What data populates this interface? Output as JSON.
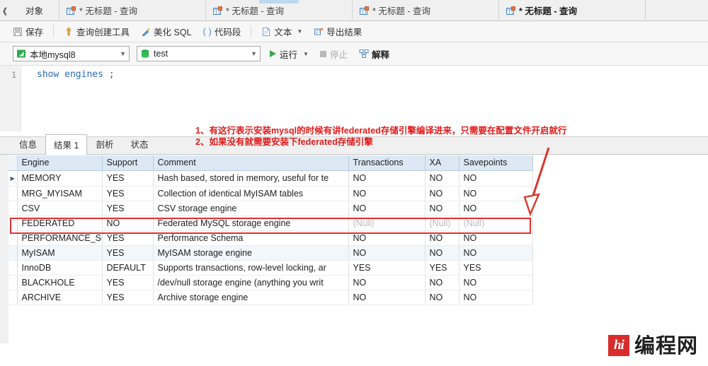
{
  "window": {
    "tabs": [
      {
        "label": "对象",
        "type": "object",
        "active": false
      },
      {
        "label": "* 无标题 - 查询",
        "type": "query",
        "active": false
      },
      {
        "label": "* 无标题 - 查询",
        "type": "query",
        "active": false
      },
      {
        "label": "* 无标题 - 查询",
        "type": "query",
        "active": false
      },
      {
        "label": "* 无标题 - 查询",
        "type": "query",
        "active": true
      }
    ]
  },
  "toolbar": {
    "save": "保存",
    "query_builder": "查询创建工具",
    "beautify": "美化 SQL",
    "snippet": "代码段",
    "snippet_prefix": "( )",
    "text": "文本",
    "export": "导出结果"
  },
  "connbar": {
    "connection": "本地mysql8",
    "database": "test",
    "run": "运行",
    "stop": "停止",
    "explain": "解释"
  },
  "editor": {
    "line_number": "1",
    "sql_keyword1": "show",
    "sql_keyword2": "engines",
    "sql_punct": ";"
  },
  "annotation": {
    "line1": "1、有这行表示安装mysql的时候有讲federated存储引擎编译进来，只需要在配置文件开启就行",
    "line2": "2、如果没有就需要安装下federated存储引擎",
    "color": "#e01b1b"
  },
  "result_tabs": [
    {
      "label": "信息",
      "selected": false
    },
    {
      "label": "结果 1",
      "selected": true
    },
    {
      "label": "剖析",
      "selected": false
    },
    {
      "label": "状态",
      "selected": false
    }
  ],
  "grid": {
    "columns": [
      "Engine",
      "Support",
      "Comment",
      "Transactions",
      "XA",
      "Savepoints"
    ],
    "rows": [
      {
        "current": true,
        "highlight": false,
        "cells": [
          "MEMORY",
          "YES",
          "Hash based, stored in memory, useful for te",
          "NO",
          "NO",
          "NO"
        ]
      },
      {
        "current": false,
        "highlight": false,
        "cells": [
          "MRG_MYISAM",
          "YES",
          "Collection of identical MyISAM tables",
          "NO",
          "NO",
          "NO"
        ]
      },
      {
        "current": false,
        "highlight": false,
        "cells": [
          "CSV",
          "YES",
          "CSV storage engine",
          "NO",
          "NO",
          "NO"
        ]
      },
      {
        "current": false,
        "highlight": true,
        "cells": [
          "FEDERATED",
          "NO",
          "Federated MySQL storage engine",
          "(Null)",
          "(Null)",
          "(Null)"
        ]
      },
      {
        "current": false,
        "highlight": false,
        "cells": [
          "PERFORMANCE_SCH",
          "YES",
          "Performance Schema",
          "NO",
          "NO",
          "NO"
        ]
      },
      {
        "current": false,
        "highlight": false,
        "cells": [
          "MyISAM",
          "YES",
          "MyISAM storage engine",
          "NO",
          "NO",
          "NO"
        ]
      },
      {
        "current": false,
        "highlight": false,
        "cells": [
          "InnoDB",
          "DEFAULT",
          "Supports transactions, row-level locking, ar",
          "YES",
          "YES",
          "YES"
        ]
      },
      {
        "current": false,
        "highlight": false,
        "cells": [
          "BLACKHOLE",
          "YES",
          "/dev/null storage engine (anything you writ",
          "NO",
          "NO",
          "NO"
        ]
      },
      {
        "current": false,
        "highlight": false,
        "cells": [
          "ARCHIVE",
          "YES",
          "Archive storage engine",
          "NO",
          "NO",
          "NO"
        ]
      }
    ]
  },
  "watermark": {
    "mark": "hi",
    "text": "编程网",
    "color": "#d92b2b"
  }
}
